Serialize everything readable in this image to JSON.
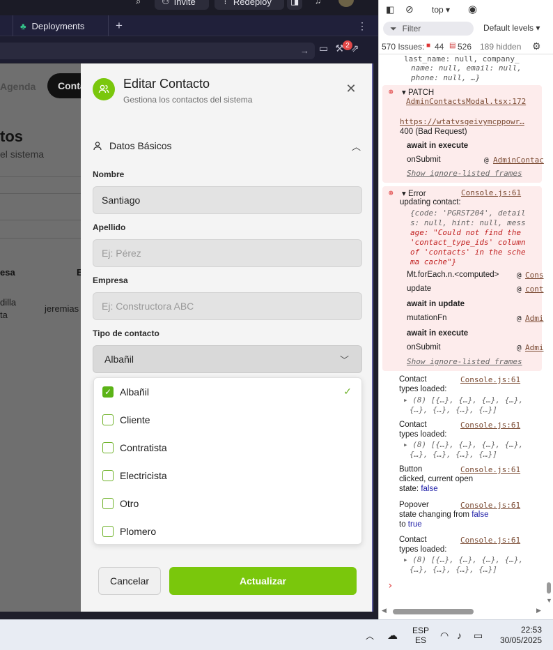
{
  "topbar": {
    "invite": "Invite",
    "redeploy": "Redeploy"
  },
  "tabs": {
    "deployments": "Deployments"
  },
  "url_badge": "2",
  "page": {
    "nav_agenda": "Agenda",
    "nav_contacts": "Conta",
    "title": "tos",
    "subtitle": "el sistema",
    "col_empresa": "esa",
    "col_e": "E",
    "cell_empresa_1": "dilla",
    "cell_empresa_2": "ta",
    "cell_email": "jeremias"
  },
  "modal": {
    "title": "Editar Contacto",
    "subtitle": "Gestiona los contactos del sistema",
    "section": "Datos Básicos",
    "nombre_label": "Nombre",
    "nombre_value": "Santiago",
    "apellido_label": "Apellido",
    "apellido_placeholder": "Ej: Pérez",
    "empresa_label": "Empresa",
    "empresa_placeholder": "Ej: Constructora ABC",
    "tipo_label": "Tipo de contacto",
    "tipo_selected": "Albañil",
    "options": [
      "Albañil",
      "Cliente",
      "Contratista",
      "Electricista",
      "Otro",
      "Plomero"
    ],
    "checked": [
      true,
      false,
      false,
      false,
      false,
      false
    ],
    "cancel": "Cancelar",
    "update": "Actualizar"
  },
  "devtools": {
    "context": "top",
    "filter": "Filter",
    "levels": "Default levels",
    "issues": "570 Issues:",
    "errors": "44",
    "messages": "526",
    "hidden": "189 hidden",
    "obj_line1": "last_name: null, company_",
    "obj_line2": "name: null, email: null,",
    "obj_line3": "phone: null, …}",
    "patch": "PATCH",
    "patch_file": "AdminContactsModal.tsx:172",
    "patch_url": "https://wtatvsgeivymcppowr…",
    "patch_status": "400 (Bad Request)",
    "await_execute": "await in execute",
    "onsubmit": "onSubmit",
    "onsubmit_link": "AdminContac",
    "show_ignored": "Show ignore-listed frames",
    "error_label": "Error",
    "console_link": "Console.js:61",
    "error_msg": "updating contact:",
    "err_obj_1": "{code: 'PGRST204', detail",
    "err_obj_2": "s: null, hint: null, mess",
    "err_obj_3": "age: \"Could not find the",
    "err_obj_4": "'contact_type_ids' column",
    "err_obj_5": "of 'contacts' in the sche",
    "err_obj_6": "ma cache\"}",
    "foreach": "Mt.forEach.n.<computed>",
    "foreach_link": "Cons",
    "update": "update",
    "update_link": "cont",
    "await_update": "await in update",
    "mutationfn": "mutationFn",
    "mutation_link": "Admi",
    "onsubmit_link2": "Admi",
    "log1_a": "Contact",
    "log1_b": "types loaded:",
    "arr_1": "(8) [{…}, {…}, {…}, {…},",
    "arr_2": "{…}, {…}, {…}, {…}]",
    "log3_a": "Button",
    "log3_b": "clicked, current open",
    "log3_c": "state:",
    "log3_false": "false",
    "log4_a": "Popover",
    "log4_b": "state changing from",
    "log4_false": "false",
    "log4_c": "to",
    "log4_true": "true",
    "prompt": "›"
  },
  "taskbar": {
    "lang1": "ESP",
    "lang2": "ES",
    "time": "22:53",
    "date": "30/05/2025"
  }
}
